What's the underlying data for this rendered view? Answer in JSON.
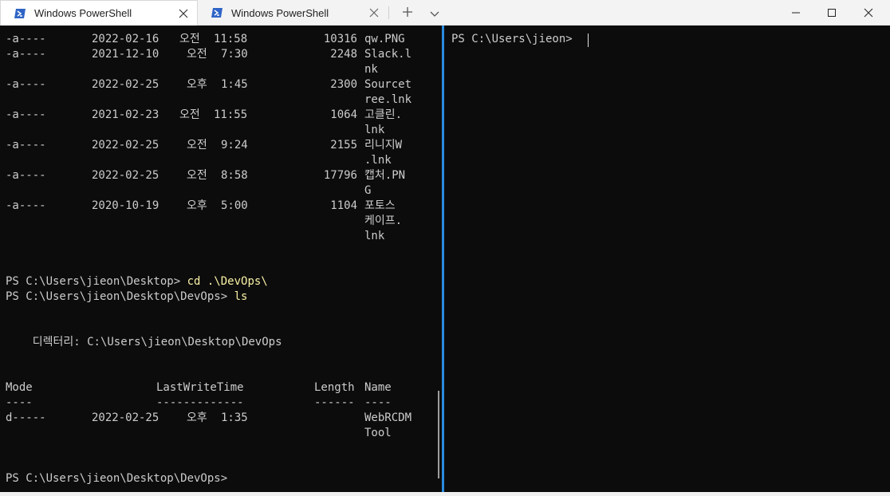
{
  "titlebar": {
    "tabs": [
      {
        "title": "Windows PowerShell",
        "active": true
      },
      {
        "title": "Windows PowerShell",
        "active": false
      }
    ],
    "new_tab_icon": "plus-icon",
    "dropdown_icon": "chevron-down-icon",
    "window_controls": [
      "minimize-icon",
      "maximize-icon",
      "close-icon"
    ]
  },
  "left_pane": {
    "files_top": [
      {
        "mode": "-a----",
        "date": "2022-02-16",
        "ampm": "오전",
        "time": "11:58",
        "length": "10316",
        "name": [
          "qw.PNG"
        ]
      },
      {
        "mode": "-a----",
        "date": "2021-12-10",
        "ampm": "오전",
        "time": "7:30",
        "length": "2248",
        "name": [
          "Slack.l",
          "nk"
        ]
      },
      {
        "mode": "-a----",
        "date": "2022-02-25",
        "ampm": "오후",
        "time": "1:45",
        "length": "2300",
        "name": [
          "Sourcet",
          "ree.lnk"
        ]
      },
      {
        "mode": "-a----",
        "date": "2021-02-23",
        "ampm": "오전",
        "time": "11:55",
        "length": "1064",
        "name": [
          "고클린.",
          "lnk"
        ]
      },
      {
        "mode": "-a----",
        "date": "2022-02-25",
        "ampm": "오전",
        "time": "9:24",
        "length": "2155",
        "name": [
          "리니지W",
          ".lnk"
        ]
      },
      {
        "mode": "-a----",
        "date": "2022-02-25",
        "ampm": "오전",
        "time": "8:58",
        "length": "17796",
        "name": [
          "캡처.PN",
          "G"
        ]
      },
      {
        "mode": "-a----",
        "date": "2020-10-19",
        "ampm": "오후",
        "time": "5:00",
        "length": "1104",
        "name": [
          "포토스",
          "케이프.",
          "lnk"
        ]
      }
    ],
    "cmd1": {
      "prompt": "PS C:\\Users\\jieon\\Desktop>",
      "command": "cd .\\DevOps\\"
    },
    "cmd2": {
      "prompt": "PS C:\\Users\\jieon\\Desktop\\DevOps>",
      "command": "ls"
    },
    "directory_line": "    디렉터리: C:\\Users\\jieon\\Desktop\\DevOps",
    "headers": {
      "mode": "Mode",
      "lastwritetime": "LastWriteTime",
      "length": "Length",
      "name": "Name"
    },
    "underlines": {
      "mode": "----",
      "lastwritetime": "-------------",
      "length": "------",
      "name": "----"
    },
    "files_bottom": [
      {
        "mode": "d-----",
        "date": "2022-02-25",
        "ampm": "오후",
        "time": "1:35",
        "length": "",
        "name": [
          "WebRCDM",
          "Tool"
        ]
      }
    ],
    "final_prompt": "PS C:\\Users\\jieon\\Desktop\\DevOps>"
  },
  "right_pane": {
    "prompt": "PS C:\\Users\\jieon>"
  },
  "colors": {
    "terminal_bg": "#0c0c0c",
    "terminal_text": "#cccccc",
    "command_text": "#f9f1a5",
    "pane_focus": "#2b8bdf"
  }
}
